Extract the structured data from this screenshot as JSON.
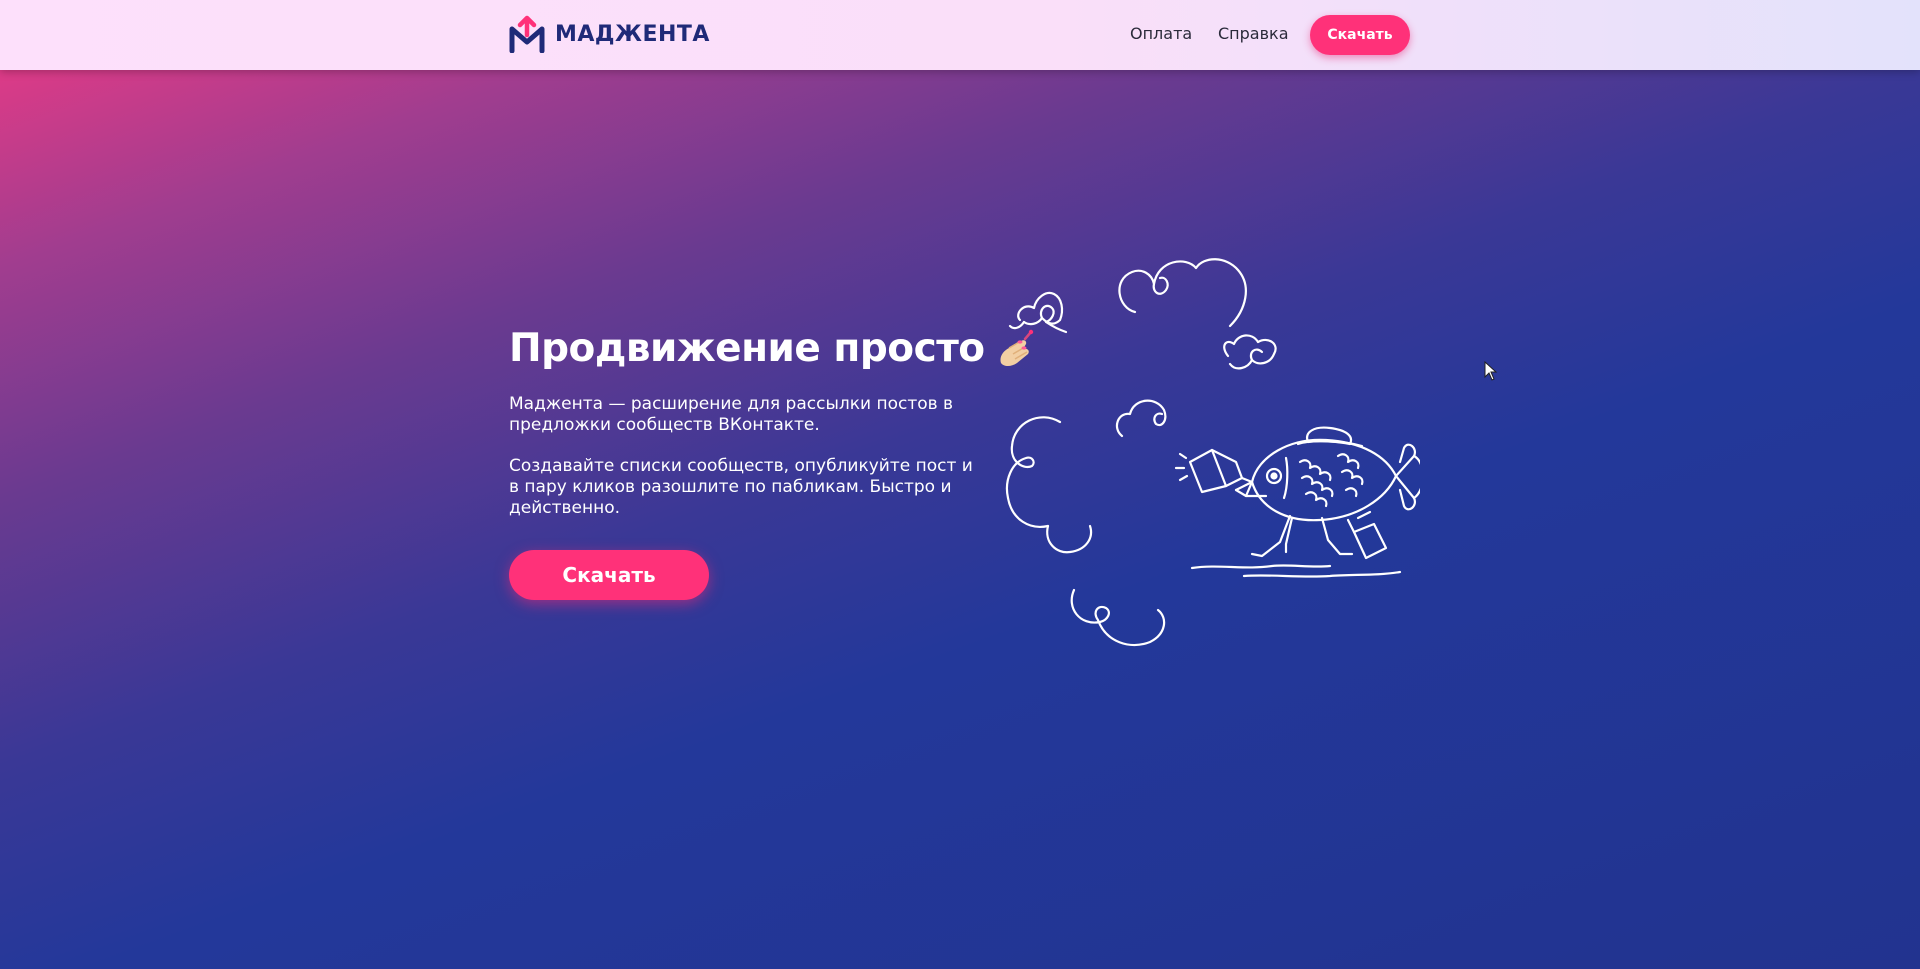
{
  "brand": {
    "name": "МАДЖЕНТА",
    "logo_icon": "magenta-m-arrow-logo",
    "accent": "#ff3179",
    "navy": "#1f2a78"
  },
  "nav": {
    "links": [
      {
        "label": "Оплата"
      },
      {
        "label": "Справка"
      }
    ],
    "download_label": "Скачать"
  },
  "hero": {
    "title": "Продвижение просто",
    "title_icon": "painting-nails-emoji",
    "paragraph1": "Маджента — расширение для рассылки постов в предложки сообществ ВКонтакте.",
    "paragraph2": "Создавайте списки сообществ, опубликуйте пост и в пару кликов разошлите по пабликам. Быстро и действенно.",
    "button_label": "Скачать",
    "illustration": "fish-with-megaphone-illustration"
  }
}
